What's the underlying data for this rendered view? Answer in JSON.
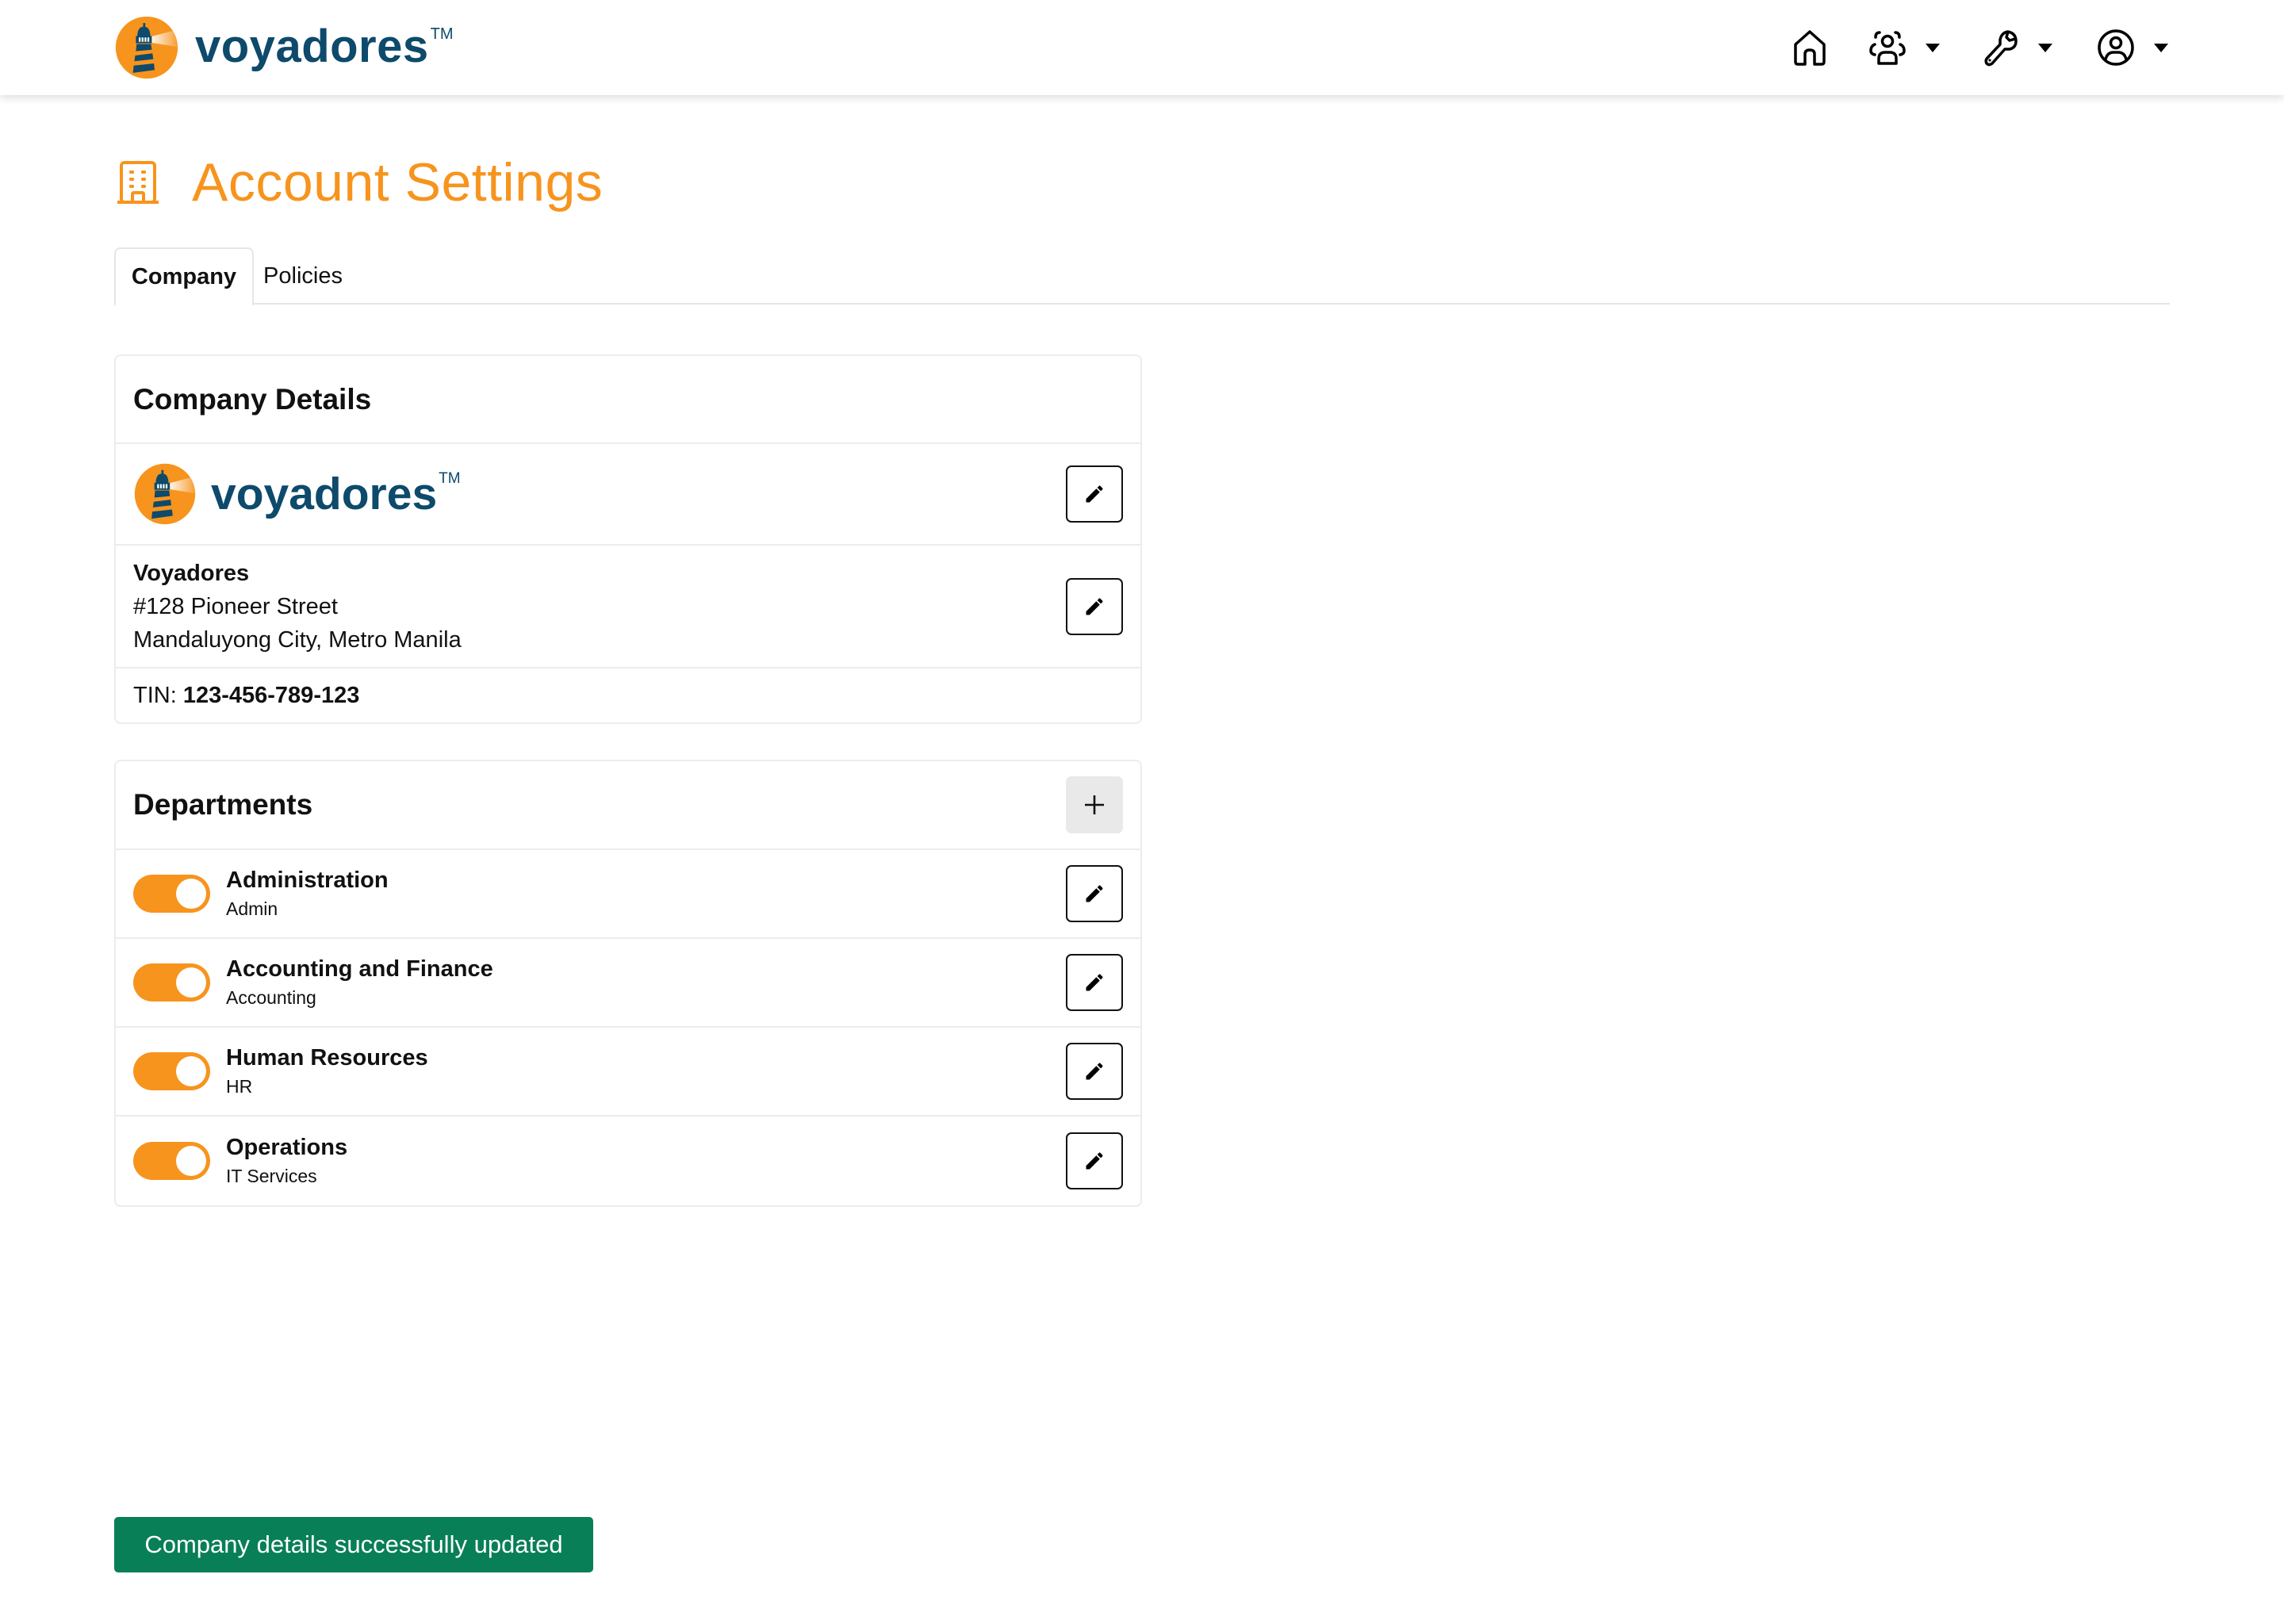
{
  "header": {
    "brand_name": "voyadores",
    "brand_tm": "TM",
    "nav": [
      {
        "icon": "home-icon",
        "has_dropdown": false
      },
      {
        "icon": "users-icon",
        "has_dropdown": true
      },
      {
        "icon": "wrench-icon",
        "has_dropdown": true
      },
      {
        "icon": "user-circle-icon",
        "has_dropdown": true
      }
    ]
  },
  "page": {
    "title": "Account Settings",
    "title_icon": "building-icon"
  },
  "tabs": [
    {
      "label": "Company",
      "active": true
    },
    {
      "label": "Policies",
      "active": false
    }
  ],
  "company_details": {
    "heading": "Company Details",
    "logo_name": "voyadores",
    "logo_tm": "TM",
    "name": "Voyadores",
    "address_line1": "#128 Pioneer Street",
    "address_line2": "Mandaluyong City, Metro Manila",
    "tin_label": "TIN:",
    "tin_value": "123-456-789-123"
  },
  "departments": {
    "heading": "Departments",
    "add_icon": "plus-icon",
    "items": [
      {
        "name": "Administration",
        "code": "Admin",
        "enabled": true
      },
      {
        "name": "Accounting and Finance",
        "code": "Accounting",
        "enabled": true
      },
      {
        "name": "Human Resources",
        "code": "HR",
        "enabled": true
      },
      {
        "name": "Operations",
        "code": "IT Services",
        "enabled": true
      }
    ]
  },
  "toast": {
    "message": "Company details successfully updated"
  },
  "colors": {
    "accent": "#F7941D",
    "brand_blue": "#0d4a6b",
    "success": "#087f56"
  }
}
